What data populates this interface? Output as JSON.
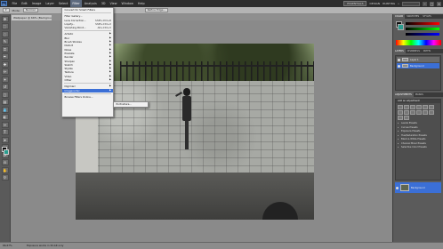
{
  "app": {
    "logo": "Ps",
    "menus": [
      "File",
      "Edit",
      "Image",
      "Layer",
      "Select",
      "Filter",
      "Analysis",
      "3D",
      "View",
      "Window",
      "Help"
    ],
    "active_menu": "Filter",
    "workspaces": [
      "ESSENTIALS",
      "DESIGN",
      "PAINTING",
      "»"
    ],
    "active_workspace": "ESSENTIALS"
  },
  "options_bar": {
    "mode_label": "Mode:",
    "mode_value": "Normal",
    "refine_label": "Refine Edge..."
  },
  "document": {
    "tab_title": "Wallpaper @ 66% (Background, RGB/8)"
  },
  "filter_menu": {
    "items": [
      {
        "label": "Convert for Smart Filters",
        "shortcut": "",
        "arrow": false
      },
      {
        "sep": true
      },
      {
        "label": "Filter Gallery...",
        "shortcut": "",
        "arrow": false
      },
      {
        "label": "Lens Correction...",
        "shortcut": "Shift+Ctrl+R",
        "arrow": false
      },
      {
        "label": "Liquify...",
        "shortcut": "Shift+Ctrl+X",
        "arrow": false
      },
      {
        "label": "Vanishing Point...",
        "shortcut": "Alt+Ctrl+V",
        "arrow": false
      },
      {
        "sep": true
      },
      {
        "label": "Artistic",
        "arrow": true
      },
      {
        "label": "Blur",
        "arrow": true
      },
      {
        "label": "Brush Strokes",
        "arrow": true
      },
      {
        "label": "Distort",
        "arrow": true
      },
      {
        "label": "Noise",
        "arrow": true
      },
      {
        "label": "Pixelate",
        "arrow": true
      },
      {
        "label": "Render",
        "arrow": true
      },
      {
        "label": "Sharpen",
        "arrow": true
      },
      {
        "label": "Sketch",
        "arrow": true
      },
      {
        "label": "Stylize",
        "arrow": true
      },
      {
        "label": "Texture",
        "arrow": true
      },
      {
        "label": "Video",
        "arrow": true
      },
      {
        "label": "Other",
        "arrow": true
      },
      {
        "sep": true
      },
      {
        "label": "Digimarc",
        "arrow": true
      },
      {
        "label": "Imagenomic",
        "arrow": true,
        "selected": true
      },
      {
        "sep": true
      },
      {
        "label": "Browse Filters Online...",
        "arrow": false
      }
    ]
  },
  "submenu": {
    "item": "Portraiture..."
  },
  "right_panel": {
    "tabs": [
      "COLOR",
      "SWATCHES",
      "STYLES"
    ],
    "layers_tabs": [
      "LAYERS",
      "CHANNELS",
      "PATHS"
    ],
    "layer_rows": [
      "Layer 1",
      "Background"
    ],
    "adj_tabs": [
      "ADJUSTMENTS",
      "MASKS"
    ],
    "adj_title": "Add an adjustment",
    "presets": [
      "Levels Presets",
      "Curves Presets",
      "Exposure Presets",
      "Hue/Saturation Presets",
      "Black & White Presets",
      "Channel Mixer Presets",
      "Selective Color Presets"
    ],
    "bottom_layer": "Background"
  },
  "status": {
    "zoom": "66.67%",
    "info": "Exposure works in 32-bit only"
  },
  "colors": {
    "menubar": "#2d2d2d",
    "selection": "#3b6fd6",
    "panel": "#5b5b5b"
  }
}
